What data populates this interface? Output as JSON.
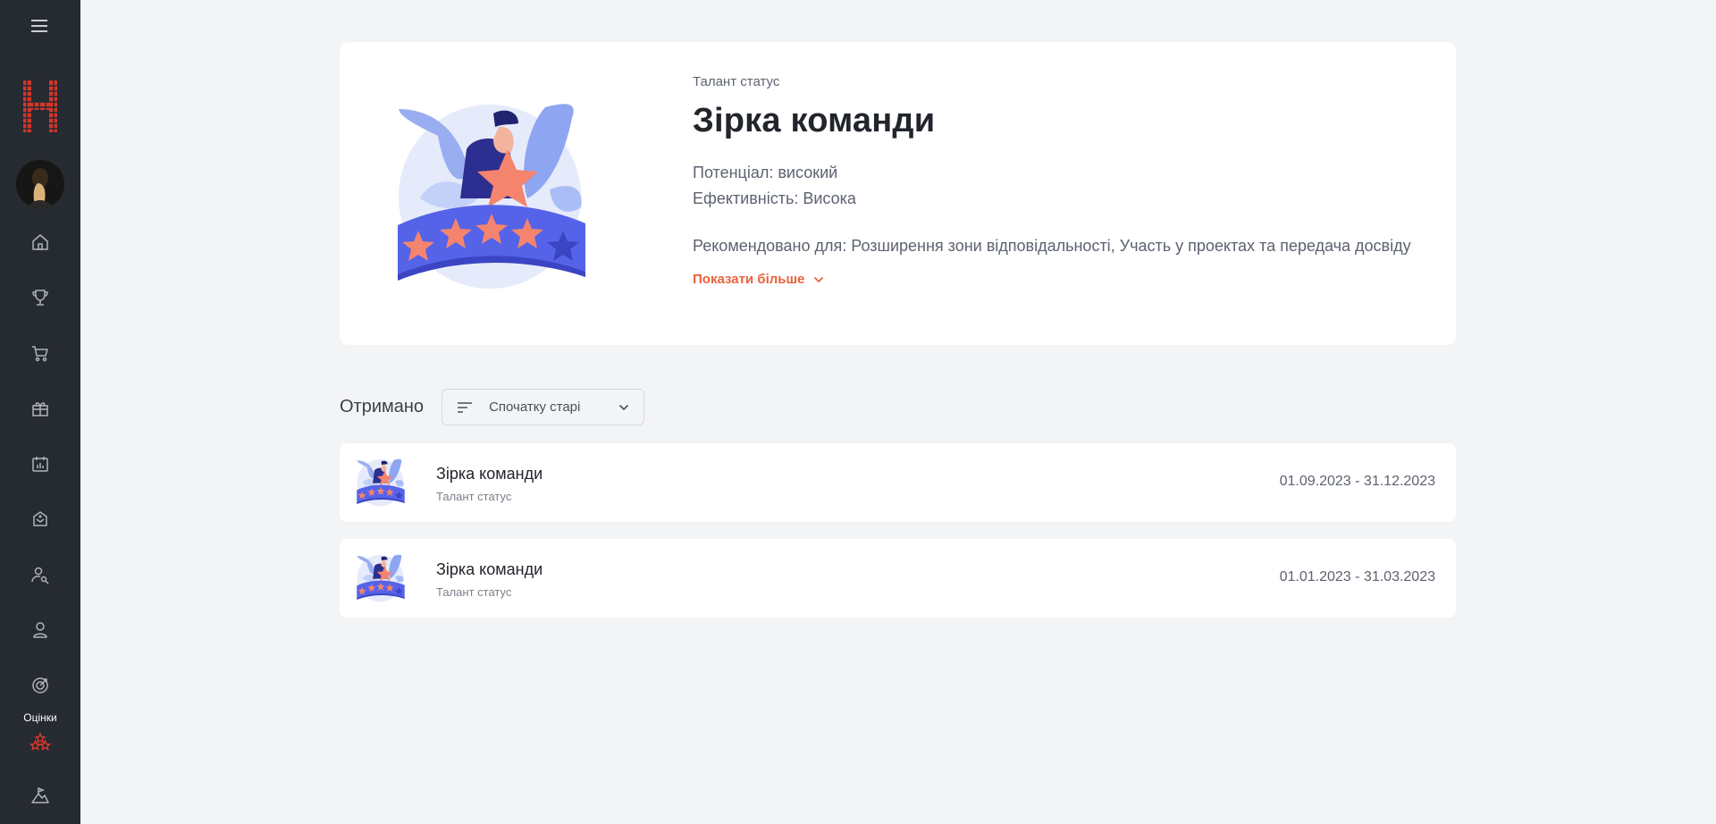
{
  "sidebar": {
    "items": [
      {
        "name": "home-icon"
      },
      {
        "name": "trophy-icon"
      },
      {
        "name": "cart-icon"
      },
      {
        "name": "gift-icon"
      },
      {
        "name": "calendar-icon"
      },
      {
        "name": "badge-icon"
      },
      {
        "name": "user-search-icon"
      },
      {
        "name": "user-icon"
      },
      {
        "name": "target-icon"
      },
      {
        "name": "stars-icon",
        "label": "Оцінки",
        "active": true
      },
      {
        "name": "mountain-icon"
      }
    ],
    "active_color": "#e5392e"
  },
  "status_card": {
    "kicker": "Талант статус",
    "title": "Зірка команди",
    "potential": "Потенціал: високий",
    "efficiency": "Ефективність: Висока",
    "recommended": "Рекомендовано для: Розширення зони відповідальності, Участь у проектах та передача досвіду",
    "show_more": "Показати більше"
  },
  "received": {
    "title": "Отримано",
    "sort_label": "Спочатку старі"
  },
  "list": [
    {
      "title": "Зірка команди",
      "subtitle": "Талант статус",
      "period": "01.09.2023 - 31.12.2023"
    },
    {
      "title": "Зірка команди",
      "subtitle": "Талант статус",
      "period": "01.01.2023 - 31.03.2023"
    }
  ],
  "colors": {
    "accent": "#e8623a",
    "sidebar_bg": "#262a31",
    "page_bg": "#f3f4f6",
    "banner_blue": "#5563e8",
    "star_coral": "#f5846e"
  }
}
